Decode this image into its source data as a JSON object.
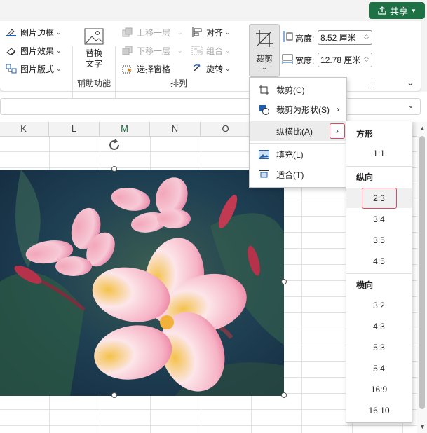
{
  "share": {
    "label": "共享"
  },
  "picture_styles": {
    "border": "图片边框",
    "effects": "图片效果",
    "layout": "图片版式"
  },
  "accessibility": {
    "alt_text_line1": "替换",
    "alt_text_line2": "文字",
    "group_label": "辅助功能"
  },
  "arrange": {
    "bring_forward": "上移一层",
    "send_backward": "下移一层",
    "selection_pane": "选择窗格",
    "align": "对齐",
    "group": "组合",
    "rotate": "旋转",
    "group_label": "排列"
  },
  "size": {
    "crop": "裁剪",
    "height_label": "高度:",
    "height_value": "8.52 厘米",
    "width_label": "宽度:",
    "width_value": "12.78 厘米"
  },
  "columns": [
    "K",
    "L",
    "M",
    "N",
    "O"
  ],
  "crop_menu": {
    "crop": "裁剪(C)",
    "crop_to_shape": "裁剪为形状(S)",
    "aspect_ratio": "纵横比(A)",
    "fill": "填充(L)",
    "fit": "适合(T)"
  },
  "aspect_menu": {
    "square_header": "方形",
    "square": [
      "1:1"
    ],
    "portrait_header": "纵向",
    "portrait": [
      "2:3",
      "3:4",
      "3:5",
      "4:5"
    ],
    "landscape_header": "横向",
    "landscape": [
      "3:2",
      "4:3",
      "5:3",
      "5:4",
      "16:9",
      "16:10"
    ],
    "selected": "2:3"
  },
  "colors": {
    "brand": "#1e7145",
    "highlight": "#e0485f"
  }
}
